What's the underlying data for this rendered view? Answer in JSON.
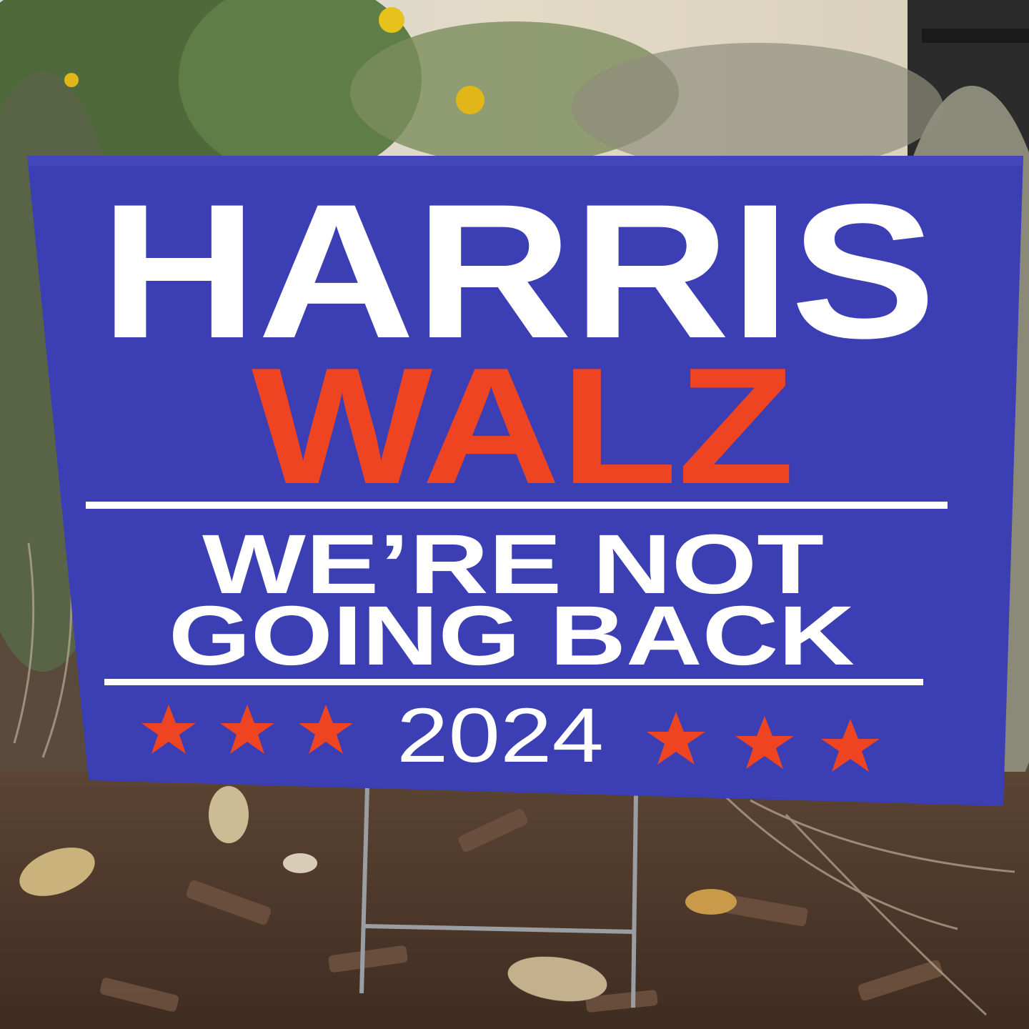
{
  "sign": {
    "line1": "HARRIS",
    "line2": "WALZ",
    "slogan_line1": "WE’RE NOT",
    "slogan_line2": "GOING BACK",
    "year": "2024"
  },
  "colors": {
    "sign_blue": "#3c3fb4",
    "name_white": "#ffffff",
    "name_red": "#ee4422",
    "star_red": "#ee4422",
    "mulch_brown": "#4b3528",
    "foliage_green": "#4e6a3a",
    "wall_cream": "#ddd3bf"
  },
  "icons": {
    "left_stars": [
      "star-icon",
      "star-icon",
      "star-icon"
    ],
    "right_stars": [
      "star-icon",
      "star-icon",
      "star-icon"
    ]
  }
}
